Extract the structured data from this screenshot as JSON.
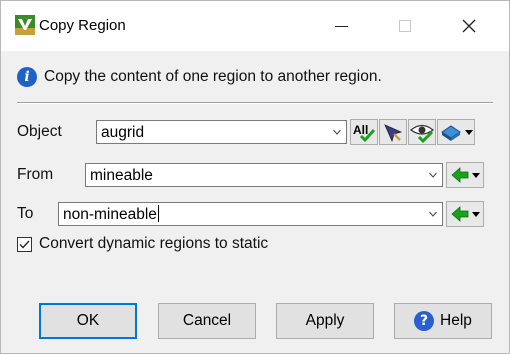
{
  "window": {
    "title": "Copy Region",
    "minimize_icon": "minimize-icon",
    "maximize_icon": "maximize-icon",
    "close_glyph": "✕"
  },
  "info": {
    "icon_glyph": "i",
    "text": "Copy the content of one region to another region."
  },
  "object": {
    "label": "Object",
    "value": "augrid",
    "all_button_label": "All",
    "tools": [
      "all-icon",
      "pick-icon",
      "eye-icon",
      "object-type-icon"
    ]
  },
  "from": {
    "label": "From",
    "value": "mineable",
    "tool": "green-arrow-left-icon"
  },
  "to": {
    "label": "To",
    "value": "non-mineable",
    "tool": "green-arrow-left-icon"
  },
  "convert_checkbox": {
    "label": "Convert dynamic regions to static",
    "checked": true
  },
  "buttons": {
    "ok": "OK",
    "cancel": "Cancel",
    "apply": "Apply",
    "help": "Help",
    "help_icon_glyph": "?"
  },
  "colors": {
    "accent": "#0078d7",
    "info_blue": "#1e62c8",
    "arrow_green": "#1aa31a"
  }
}
